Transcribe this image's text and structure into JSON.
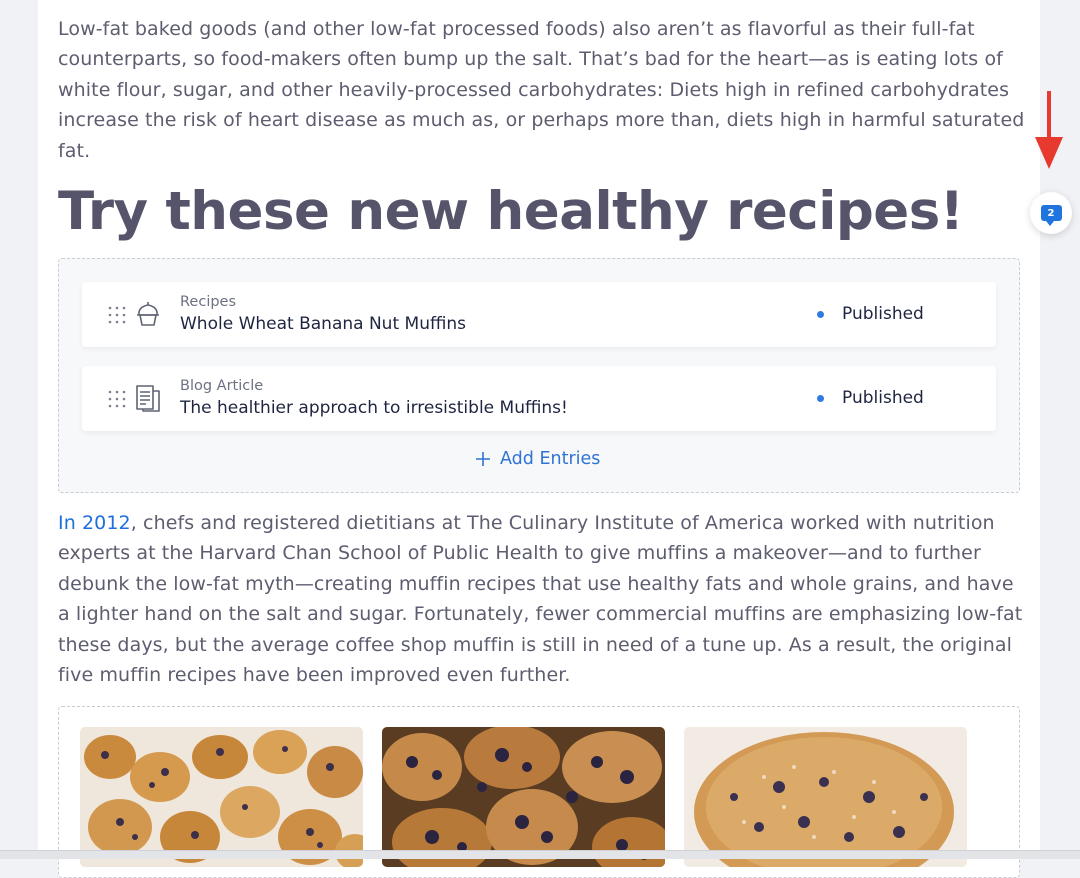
{
  "article": {
    "para1": "Low-fat baked goods (and other low-fat processed foods) also aren’t as flavorful as their full-fat counterparts, so food-makers often bump up the salt. That’s bad for the heart—as is eating lots of white flour, sugar, and other heavily-processed carbohydrates: Diets high in refined carbohydrates increase the risk of heart disease as much as, or perhaps more than, diets high in harmful saturated fat.",
    "heading": "Try these new healthy recipes!",
    "para2_link": "In 2012",
    "para2_rest": ", chefs and registered dietitians at The Culinary Institute of America worked with nutrition experts at the Harvard Chan School of Public Health to give muffins a makeover—and to further debunk the low-fat myth—creating muffin recipes that use healthy fats and whole grains, and have a lighter hand on the salt and sugar. Fortunately, fewer commercial muffins are emphasizing low-fat these days, but the average coffee shop muffin is still in need of a tune up. As a result, the original five muffin recipes have been improved even further."
  },
  "entries": [
    {
      "type": "Recipes",
      "title": "Whole Wheat Banana Nut Muffins",
      "status": "Published",
      "icon": "cupcake-icon"
    },
    {
      "type": "Blog Article",
      "title": "The healthier approach to irresistible Muffins!",
      "status": "Published",
      "icon": "document-icon"
    }
  ],
  "add_entries_label": "Add Entries",
  "comments": {
    "count": "2"
  },
  "colors": {
    "accent": "#1f74e0",
    "arrow": "#e8392f",
    "heading": "#55546b"
  }
}
